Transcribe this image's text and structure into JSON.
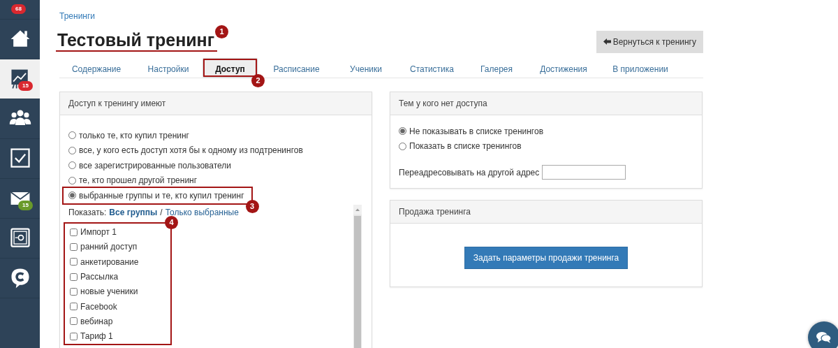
{
  "sidebar": {
    "top_badge": {
      "text": "68",
      "color": "#d9282f"
    },
    "items": [
      {
        "kind": "home",
        "selected": false
      },
      {
        "kind": "training",
        "selected": true,
        "badge": {
          "text": "15",
          "color": "#d9282f"
        }
      },
      {
        "kind": "people",
        "selected": false
      },
      {
        "kind": "tasks",
        "selected": false
      },
      {
        "kind": "mail",
        "selected": false,
        "badge": {
          "text": "15",
          "color": "#6a9a2a"
        }
      },
      {
        "kind": "safe",
        "selected": false
      },
      {
        "kind": "chat",
        "selected": false
      }
    ]
  },
  "breadcrumb": "Тренинги",
  "title": {
    "text": "Тестовый тренинг",
    "marker": "1"
  },
  "back_button": "Вернуться к тренингу",
  "tabs": [
    {
      "label": "Содержание",
      "selected": false
    },
    {
      "label": "Настройки",
      "selected": false
    },
    {
      "label": "Доступ",
      "selected": true,
      "marker": "2"
    },
    {
      "label": "Расписание",
      "selected": false
    },
    {
      "label": "Ученики",
      "selected": false
    },
    {
      "label": "Статистика",
      "selected": false
    },
    {
      "label": "Галерея",
      "selected": false
    },
    {
      "label": "Достижения",
      "selected": false
    },
    {
      "label": "В приложении",
      "selected": false
    }
  ],
  "access_panel": {
    "title": "Доступ к тренингу имеют",
    "options": [
      {
        "label": "только те, кто купил тренинг",
        "selected": false
      },
      {
        "label": "все, у кого есть доступ хотя бы к одному из подтренингов",
        "selected": false
      },
      {
        "label": "все зарегистрированные пользователи",
        "selected": false
      },
      {
        "label": "те, кто прошел другой тренинг",
        "selected": false
      },
      {
        "label": "выбранные группы и те, кто купил тренинг",
        "selected": true,
        "marker": "3"
      }
    ],
    "show_label": "Показать:",
    "filters": [
      {
        "label": "Все группы",
        "selected": true
      },
      {
        "label": "Только выбранные",
        "selected": false
      }
    ],
    "filter_separator": "/",
    "groups_marker": "4",
    "groups": [
      {
        "label": "Импорт 1",
        "checked": false
      },
      {
        "label": "ранний доступ",
        "checked": false
      },
      {
        "label": "анкетирование",
        "checked": false
      },
      {
        "label": "Рассылка",
        "checked": false
      },
      {
        "label": "новые ученики",
        "checked": false
      },
      {
        "label": "Facebook",
        "checked": false
      },
      {
        "label": "вебинар",
        "checked": false
      },
      {
        "label": "Тариф 1",
        "checked": false
      }
    ]
  },
  "no_access_panel": {
    "title": "Тем у кого нет доступа",
    "options": [
      {
        "label": "Не показывать в списке тренингов",
        "selected": true
      },
      {
        "label": "Показать в списке тренингов",
        "selected": false
      }
    ],
    "redirect_label": "Переадресовывать на другой адрес"
  },
  "sale_panel": {
    "title": "Продажа тренинга",
    "button": "Задать параметры продажи тренинга"
  }
}
